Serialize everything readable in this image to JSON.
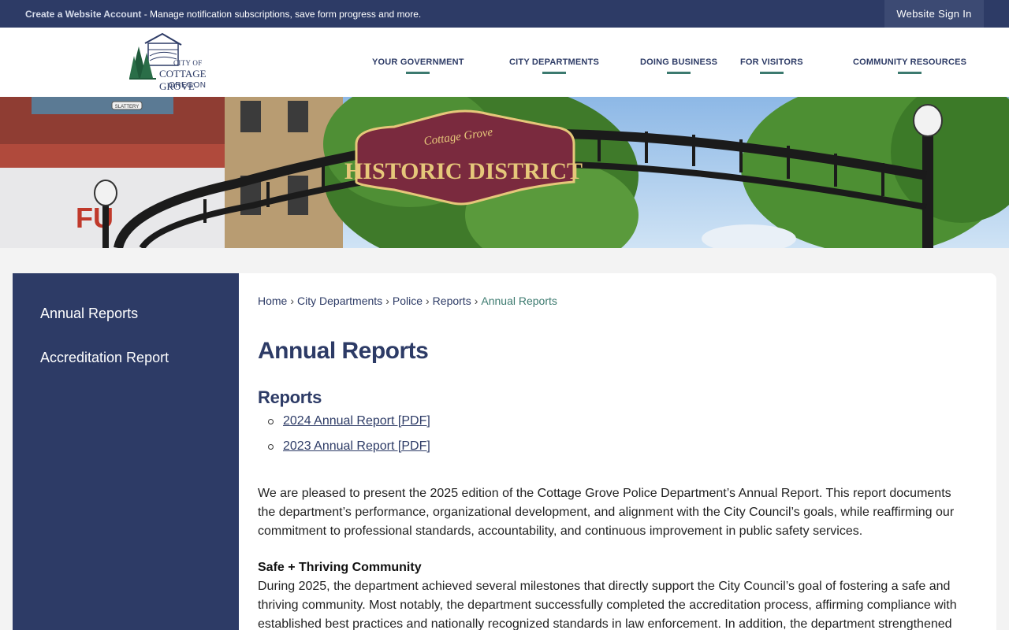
{
  "topbar": {
    "account_link": "Create a Website Account",
    "message": " - Manage notification subscriptions, save form progress and more.",
    "sign_in": "Website Sign In"
  },
  "logo": {
    "line1": "CITY OF",
    "line2": "COTTAGE GROVE",
    "line3": "OREGON"
  },
  "nav": [
    {
      "label": "YOUR GOVERNMENT"
    },
    {
      "label": "CITY DEPARTMENTS"
    },
    {
      "label": "DOING BUSINESS"
    },
    {
      "label": "FOR VISITORS"
    },
    {
      "label": "COMMUNITY RESOURCES"
    }
  ],
  "hero": {
    "sign_top": "Cottage Grove",
    "sign_main": "HISTORIC DISTRICT",
    "street_sign": "SLATTERY"
  },
  "sidebar": {
    "items": [
      {
        "label": "Annual Reports"
      },
      {
        "label": "Accreditation Report"
      }
    ]
  },
  "breadcrumb": {
    "items": [
      "Home",
      "City Departments",
      "Police",
      "Reports",
      "Annual Reports"
    ],
    "separator": "›"
  },
  "main": {
    "title": "Annual Reports",
    "section_title": "Reports",
    "reports": [
      {
        "label": "2024 Annual Report [PDF]"
      },
      {
        "label": "2023 Annual Report [PDF]"
      }
    ],
    "intro": "We are pleased to present the 2025 edition of the Cottage Grove Police Department’s Annual Report. This report documents the department’s performance, organizational development, and alignment with the City Council’s goals, while reaffirming our commitment to professional standards, accountability, and continuous improvement in public safety services.",
    "subhead": "Safe + Thriving Community",
    "body": "During 2025, the department achieved several milestones that directly support the City Council’s goal of fostering a safe and thriving community. Most notably, the department successfully completed the accreditation process, affirming compliance with established best practices and nationally recognized standards in law enforcement. In addition, the department strengthened"
  },
  "colors": {
    "navy": "#2d3b66",
    "teal": "#3c7a6f",
    "sign_maroon": "#7a2a3e",
    "sign_gold": "#e6c77a"
  }
}
